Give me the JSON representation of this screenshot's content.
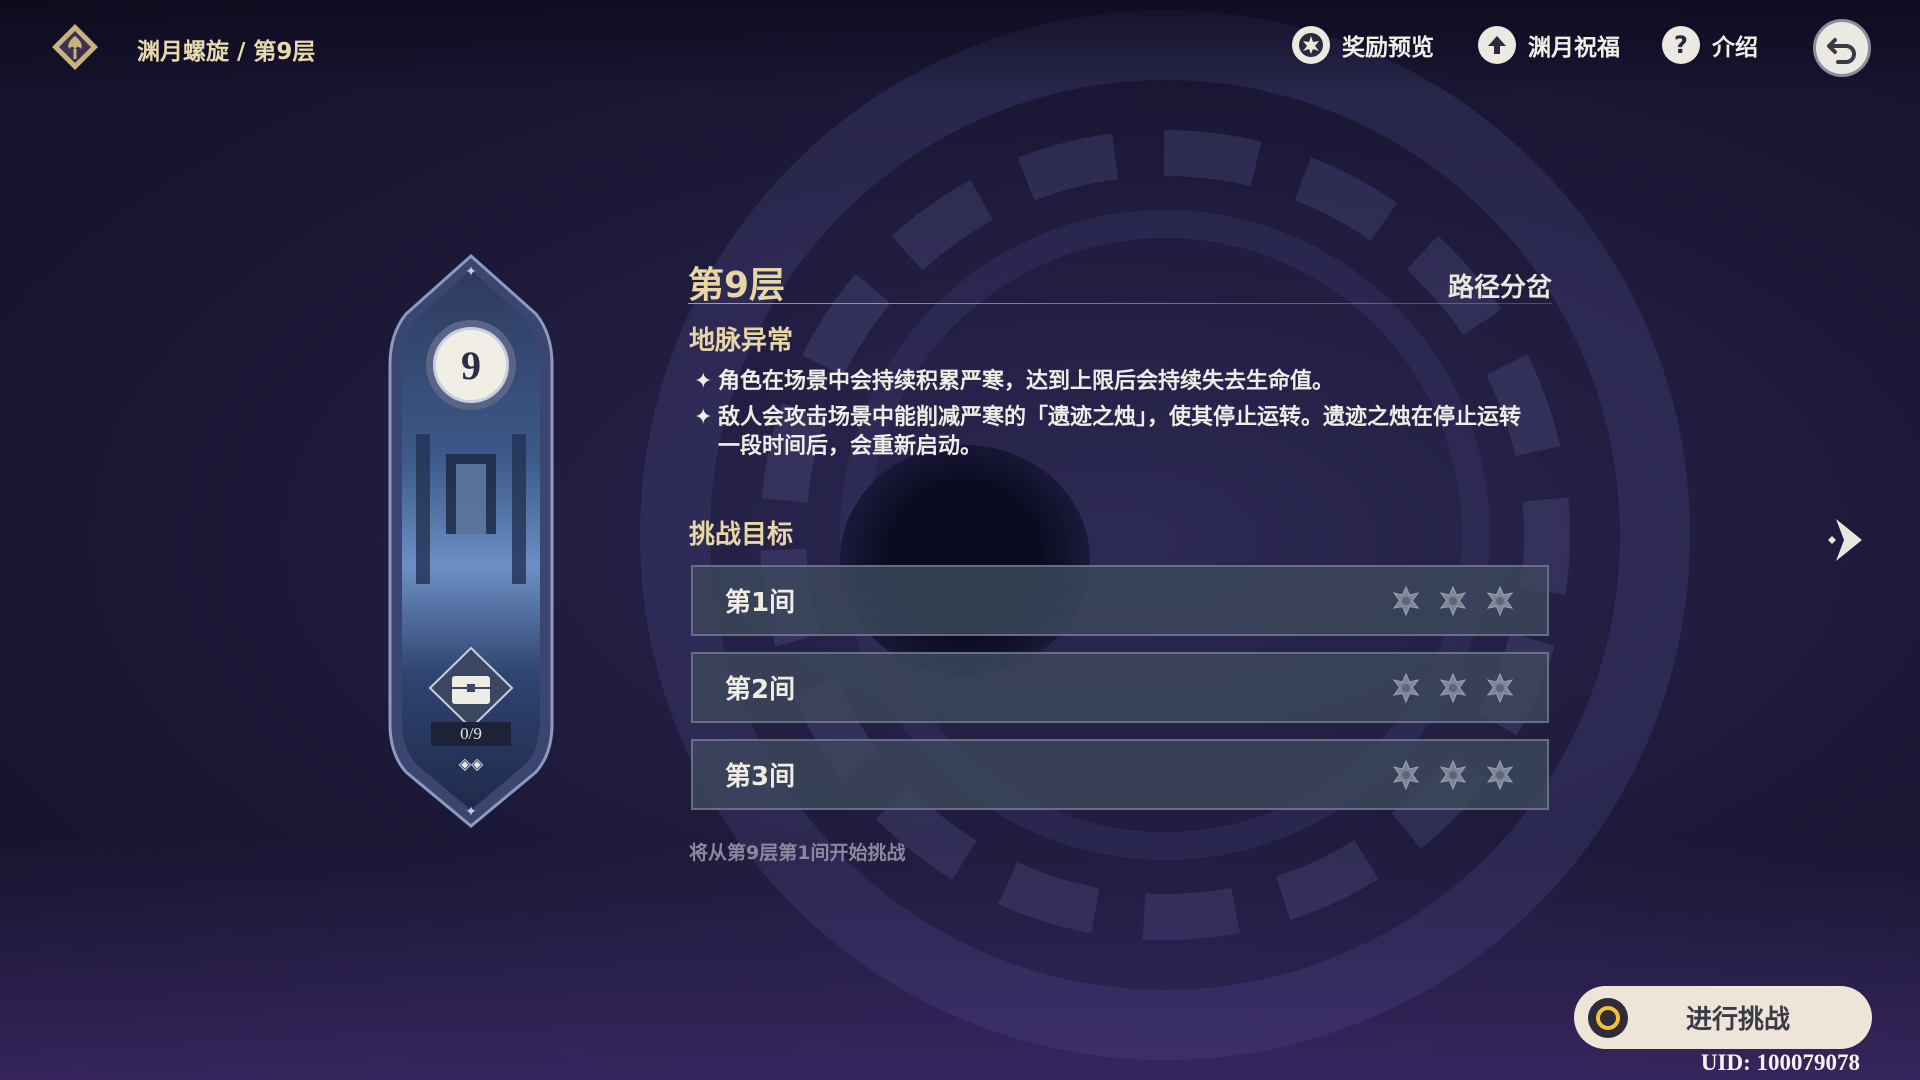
{
  "header": {
    "breadcrumb": "渊月螺旋 / 第9层",
    "buttons": [
      {
        "label": "奖励预览",
        "icon": "reward-star-icon"
      },
      {
        "label": "渊月祝福",
        "icon": "blessing-arrow-icon"
      },
      {
        "label": "介绍",
        "icon": "help-icon",
        "glyph": "?"
      }
    ],
    "back_icon": "back-arrow-icon"
  },
  "floor_card": {
    "number": "9",
    "chest_progress": "0/9"
  },
  "panel": {
    "title": "第9层",
    "route": "路径分岔",
    "ley_title": "地脉异常",
    "bullet": "✦",
    "ley_lines": [
      "角色在场景中会持续积累严寒，达到上限后会持续失去生命值。",
      "敌人会攻击场景中能削减严寒的「遗迹之烛」，使其停止运转。遗迹之烛在停止运转一段时间后，会重新启动。"
    ],
    "objective_title": "挑战目标",
    "chambers": [
      {
        "name": "第1间",
        "stars_earned": 0,
        "stars_total": 3
      },
      {
        "name": "第2间",
        "stars_earned": 0,
        "stars_total": 3
      },
      {
        "name": "第3间",
        "stars_earned": 0,
        "stars_total": 3
      }
    ],
    "hint": "将从第9层第1间开始挑战"
  },
  "footer": {
    "start_label": "进行挑战",
    "uid": "UID: 100079078"
  },
  "colors": {
    "accent_gold": "#e9d6a6",
    "button_light": "#ece5d8",
    "chamber_bg": "#3c485c",
    "background": "#1a1735"
  }
}
